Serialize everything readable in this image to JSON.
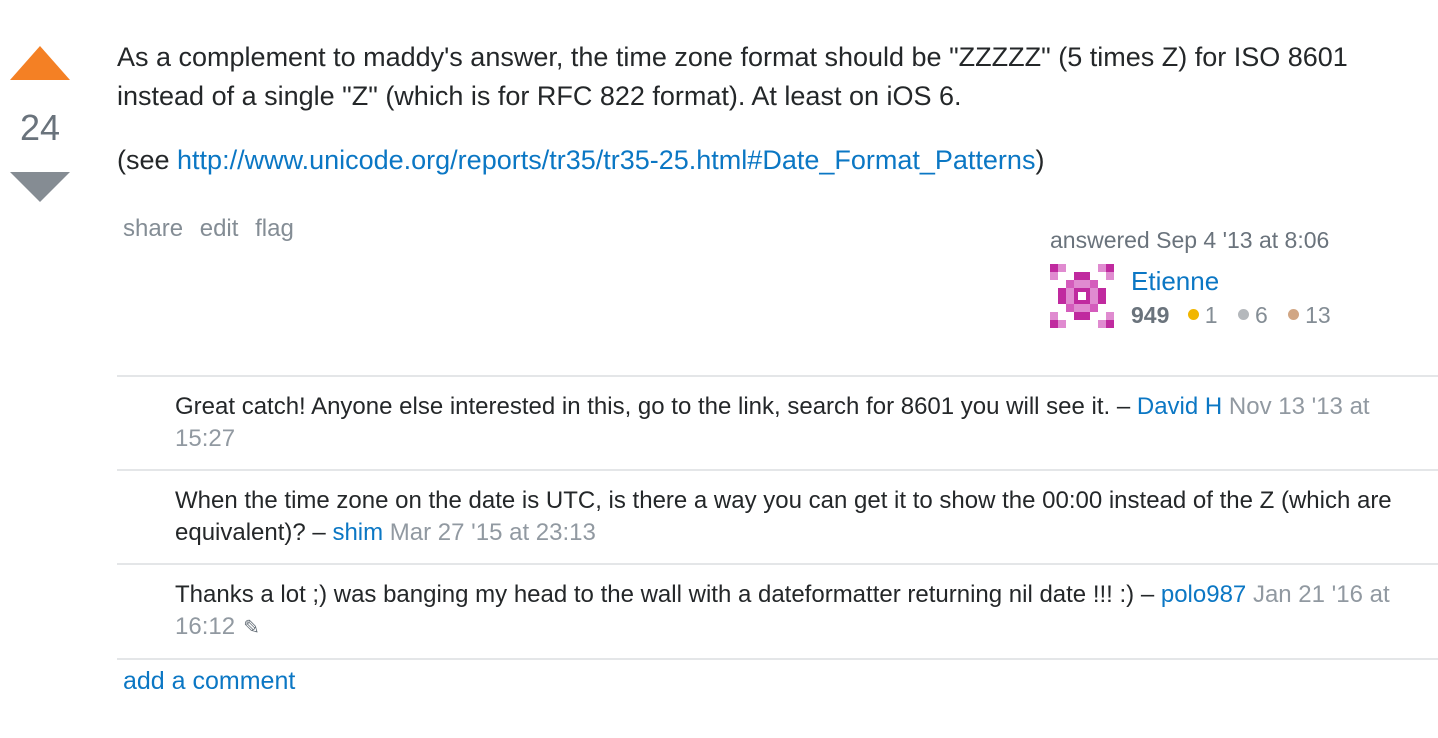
{
  "vote": {
    "count": "24"
  },
  "answer": {
    "paragraph1": "As a complement to maddy's answer, the time zone format should be \"ZZZZZ\" (5 times Z) for ISO 8601 instead of a single \"Z\" (which is for RFC 822 format). At least on iOS 6.",
    "see_prefix": "(see ",
    "link_text": "http://www.unicode.org/reports/tr35/tr35-25.html#Date_Format_Patterns",
    "see_suffix": ")"
  },
  "menu": {
    "share": "share",
    "edit": "edit",
    "flag": "flag"
  },
  "user_card": {
    "answered": "answered Sep 4 '13 at 8:06",
    "name": "Etienne",
    "reputation": "949",
    "gold": "1",
    "silver": "6",
    "bronze": "13"
  },
  "colors": {
    "upvote": "#f48024",
    "downvote": "#858c93",
    "link": "#0b77c4",
    "gold": "#f1b600",
    "silver": "#b4b8bc",
    "bronze": "#d1a684",
    "avatar": "#c02a9f"
  },
  "comments": [
    {
      "text": "Great catch! Anyone else interested in this, go to the link, search for 8601 you will see it. – ",
      "author": "David H",
      "date": "Nov 13 '13 at 15:27"
    },
    {
      "text": "When the time zone on the date is UTC, is there a way you can get it to show the 00:00 instead of the Z (which are equivalent)? – ",
      "author": "shim",
      "date": "Mar 27 '15 at 23:13"
    },
    {
      "text": "Thanks a lot ;) was banging my head to the wall with a dateformatter returning nil date !!! :) – ",
      "author": "polo987",
      "date": "Jan 21 '16 at 16:12",
      "edited": true
    }
  ],
  "add_comment": "add a comment"
}
